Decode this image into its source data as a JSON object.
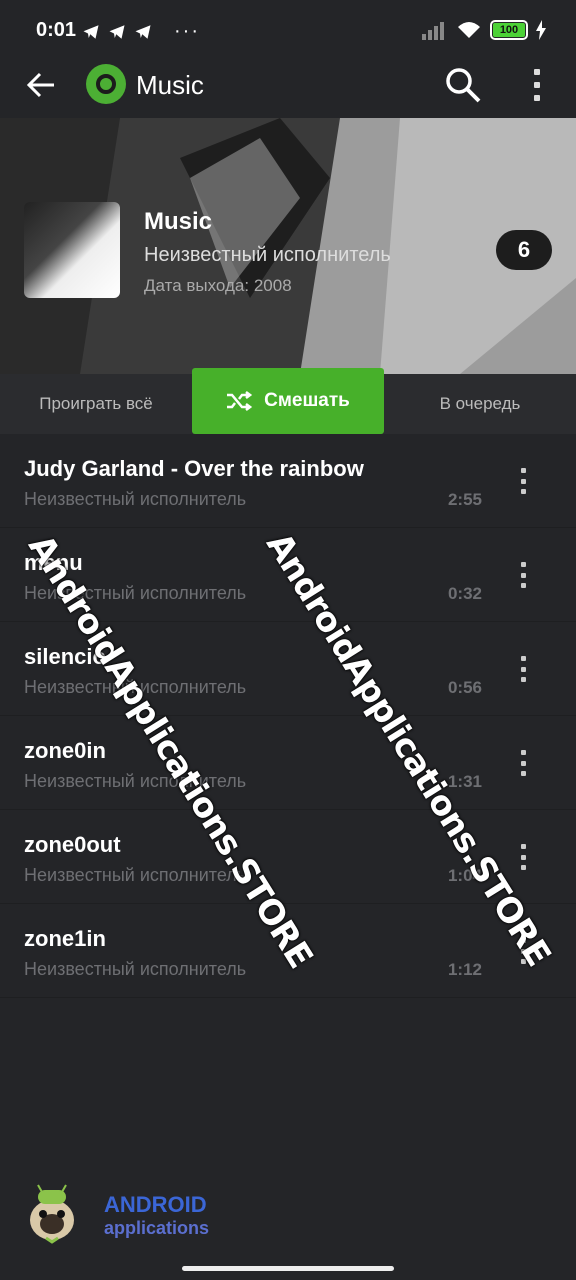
{
  "status_bar": {
    "time": "0:01",
    "more": "···",
    "battery": "100"
  },
  "app_bar": {
    "title": "Music"
  },
  "album": {
    "title": "Music",
    "artist": "Неизвестный исполнитель",
    "release": "Дата выхода: 2008",
    "track_count": "6"
  },
  "actions": {
    "play_all": "Проиграть всё",
    "shuffle": "Смешать",
    "queue": "В очередь"
  },
  "tracks": [
    {
      "title": "Judy Garland - Over the rainbow",
      "artist": "Неизвестный исполнитель",
      "duration": "2:55"
    },
    {
      "title": "menu",
      "artist": "Неизвестный исполнитель",
      "duration": "0:32"
    },
    {
      "title": "silencio",
      "artist": "Неизвестный исполнитель",
      "duration": "0:56"
    },
    {
      "title": "zone0in",
      "artist": "Неизвестный исполнитель",
      "duration": "1:31"
    },
    {
      "title": "zone0out",
      "artist": "Неизвестный исполнитель",
      "duration": "1:04"
    },
    {
      "title": "zone1in",
      "artist": "Неизвестный исполнитель",
      "duration": "1:12"
    }
  ],
  "watermark": "AndroidApplications.STORE",
  "branding": {
    "title": "ANDROID",
    "subtitle": "applications"
  },
  "colors": {
    "accent": "#47b02a",
    "background": "#242528"
  }
}
